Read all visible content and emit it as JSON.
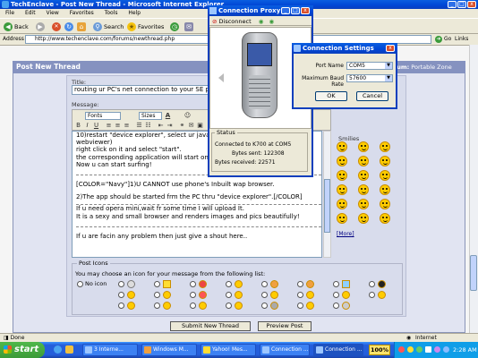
{
  "ie": {
    "title": "TechEnclave - Post New Thread - Microsoft Internet Explorer",
    "menu": [
      "File",
      "Edit",
      "View",
      "Favorites",
      "Tools",
      "Help"
    ],
    "toolbar": {
      "back": "Back",
      "search": "Search",
      "favorites": "Favorites"
    },
    "address_label": "Address",
    "address": "http://www.techenclave.com/forums/newthread.php",
    "go": "Go",
    "links": "Links",
    "status": "Done",
    "zone": "Internet"
  },
  "form": {
    "header": "Post New Thread",
    "forum_label": "rum:",
    "forum_name": "Portable Zone",
    "title_label": "Title:",
    "title_value": "routing ur PC's net connection to your SE ph",
    "message_label": "Message:",
    "font_select": "Fonts",
    "size_select": "Sizes",
    "message_lines": [
      "10)restart \"device explorer\", select ur java",
      "webviewer)",
      "right click on it and select \"start\".",
      "the corresponding application will start on",
      "Now u can start surfing!",
      "",
      "[COLOR=\"Navy\"]1)U CANNOT use phone's Inbuilt wap browser.",
      "",
      "2)The app should be started  frm the PC thru \"device explorer\".[/COLOR]",
      "",
      "If u need opera mini,wait fr some time I will upload It.",
      "It is a sexy and small browser and renders images and pics beautifully!",
      "",
      "",
      "If u are facin any problem then just give a shout here.."
    ],
    "smilies_label": "Smilies",
    "more_label": "[More]",
    "post_icons_label": "Post Icons",
    "post_icons_text": "You may choose an icon for your message from the following list:",
    "no_icon_label": "No icon",
    "submit_label": "Submit New Thread",
    "preview_label": "Preview Post"
  },
  "proxy": {
    "title": "Connection Proxy",
    "disconnect": "Disconnect",
    "status_label": "Status",
    "connected": "Connected to K700 at COM5",
    "sent_label": "Bytes sent:",
    "sent": "122308",
    "received_label": "Bytes received:",
    "received": "22571"
  },
  "settings": {
    "title": "Connection Settings",
    "port_label": "Port Name",
    "port_value": "COM5",
    "baud_label": "Maximum Baud Rate",
    "baud_value": "57600",
    "ok": "OK",
    "cancel": "Cancel"
  },
  "taskbar": {
    "start": "start",
    "tasks": [
      "3 Interne...",
      "Windows M...",
      "Yahoo! Mes...",
      "Connection ...",
      "Connection ..."
    ],
    "battery": "100%",
    "time": "2:28 AM"
  },
  "colors": {
    "xp_blue": "#0046d5",
    "panel_header": "#8592c0",
    "start_green": "#3c9b39"
  }
}
